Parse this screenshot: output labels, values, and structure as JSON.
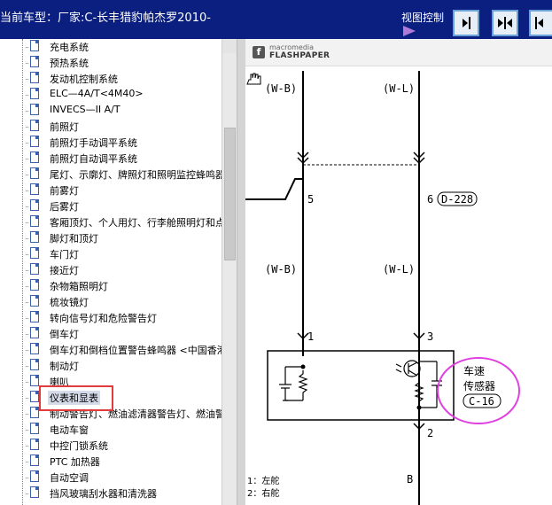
{
  "header": {
    "title": "当前车型：厂家:C-长丰猎豹帕杰罗2010-",
    "view_control_label": "视图控制"
  },
  "view_buttons": [
    {
      "icon": "collapse-right-icon"
    },
    {
      "icon": "split-view-icon"
    },
    {
      "icon": "collapse-left-icon"
    }
  ],
  "sidebar": {
    "items": [
      {
        "label": "充电系统"
      },
      {
        "label": "预热系统"
      },
      {
        "label": "发动机控制系统"
      },
      {
        "label": "ELC—4A/T<4M40>"
      },
      {
        "label": "INVECS—II A/T"
      },
      {
        "label": "前照灯"
      },
      {
        "label": "前照灯手动调平系统"
      },
      {
        "label": "前照灯自动调平系统"
      },
      {
        "label": "尾灯、示廓灯、牌照灯和照明监控蜂鸣器"
      },
      {
        "label": "前雾灯"
      },
      {
        "label": "后雾灯"
      },
      {
        "label": "客厢顶灯、个人用灯、行李舱照明灯和点"
      },
      {
        "label": "脚灯和顶灯"
      },
      {
        "label": "车门灯"
      },
      {
        "label": "接近灯"
      },
      {
        "label": "杂物箱照明灯"
      },
      {
        "label": "梳妆镜灯"
      },
      {
        "label": "转向信号灯和危险警告灯"
      },
      {
        "label": "倒车灯"
      },
      {
        "label": "倒车灯和倒档位置警告蜂鸣器 <中国香港"
      },
      {
        "label": "制动灯"
      },
      {
        "label": "喇叭"
      },
      {
        "label": "仪表和显表",
        "selected": true
      },
      {
        "label": "制动警告灯、燃油滤清器警告灯、燃油警"
      },
      {
        "label": "电动车窗"
      },
      {
        "label": "中控门锁系统"
      },
      {
        "label": "PTC 加热器"
      },
      {
        "label": "自动空调"
      },
      {
        "label": "挡风玻璃刮水器和清洗器"
      }
    ]
  },
  "viewer": {
    "brand": "macromedia",
    "product": "FLASHPAPER",
    "diagram": {
      "wire_top_left": "(W-B)",
      "wire_top_right": "(W-L)",
      "pin_5": "5",
      "pin_6": "6",
      "connector_top": "D-228",
      "wire_mid_left": "(W-B)",
      "wire_mid_right": "(W-L)",
      "pin_1": "1",
      "pin_3": "3",
      "pin_2": "2",
      "sensor_line1": "车速",
      "sensor_line2": "传感器",
      "sensor_connector": "C-16",
      "wire_bottom": "B",
      "legend_1": "1：左舵",
      "legend_2": "2：右舵"
    }
  },
  "colors": {
    "header_bg": "#0a1f7f",
    "selection_box": "#e33b3b",
    "sensor_circle": "#e040e0"
  }
}
